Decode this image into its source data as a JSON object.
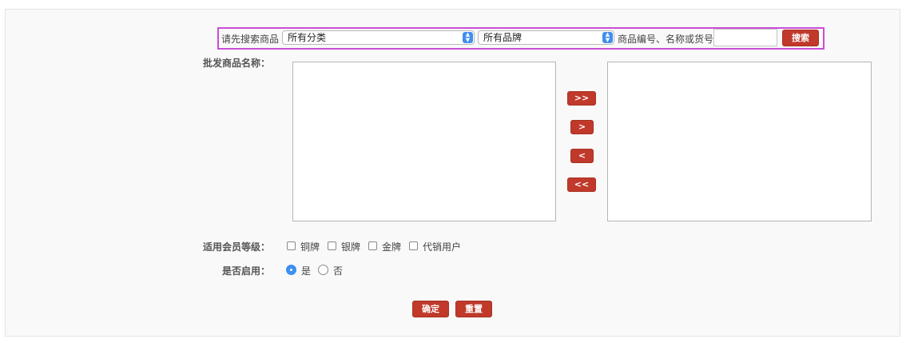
{
  "search": {
    "prompt_label": "请先搜索商品",
    "category_select": "所有分类",
    "brand_select": "所有品牌",
    "keyword_label": "商品编号、名称或货号",
    "keyword_value": "",
    "search_button": "搜索"
  },
  "goods": {
    "label": "批发商品名称：",
    "move_all_right": ">>",
    "move_right": ">",
    "move_left": "<",
    "move_all_left": "<<"
  },
  "member_levels": {
    "label": "适用会员等级：",
    "options": [
      "铜牌",
      "银牌",
      "金牌",
      "代销用户"
    ]
  },
  "enabled": {
    "label": "是否启用：",
    "yes": "是",
    "no": "否",
    "selected": "是"
  },
  "actions": {
    "confirm": "确定",
    "reset": "重置"
  },
  "colors": {
    "accent_red": "#c0392b",
    "highlight_border": "#c84fd6",
    "select_arrow_blue": "#3f8ef0"
  }
}
